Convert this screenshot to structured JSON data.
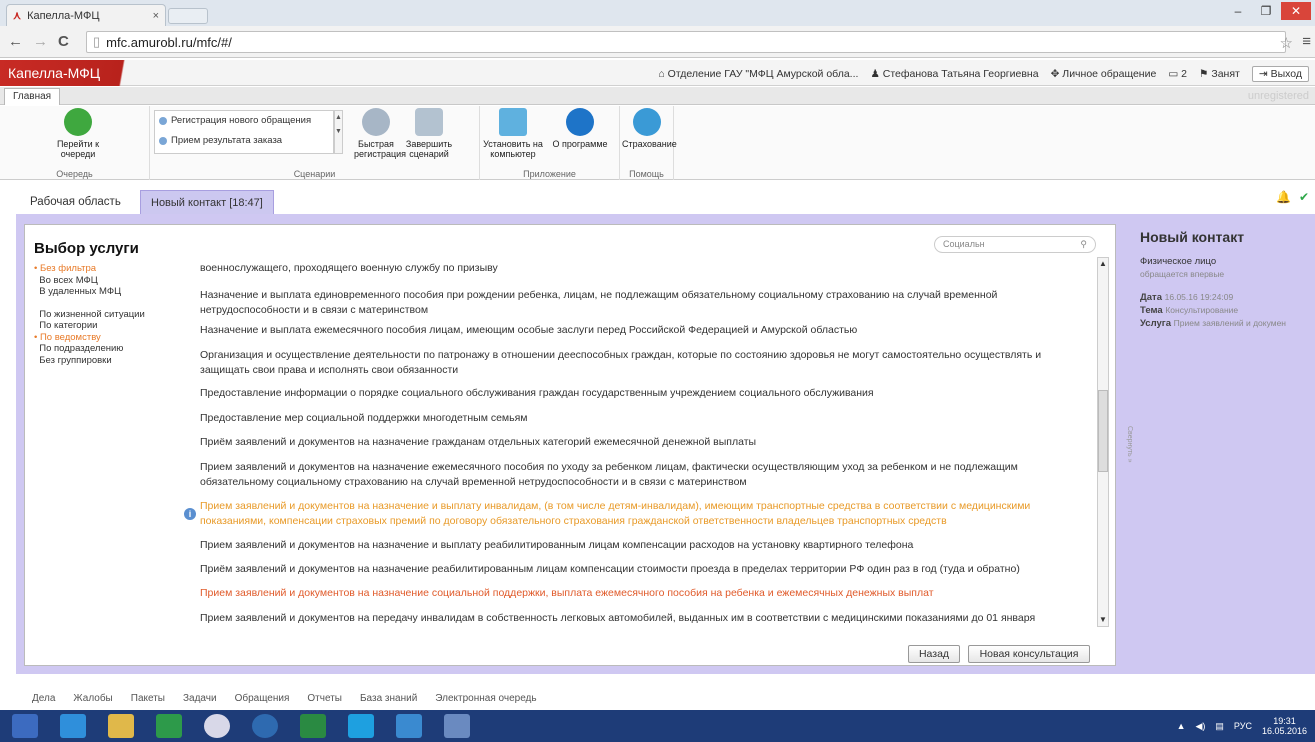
{
  "browser": {
    "tab_title": "Капелла-МФЦ",
    "tab_close": "×",
    "url": "mfc.amurobl.ru/mfc/#/"
  },
  "header": {
    "logo": "Капелла-МФЦ",
    "office": "Отделение ГАУ \"МФЦ Амурской обла...",
    "user": "Стефанова Татьяна Георгиевна",
    "mode": "Личное обращение",
    "window": "2",
    "status": "Занят",
    "logout": "Выход"
  },
  "ribbon": {
    "tab": "Главная",
    "unregistered": "unregistered",
    "queue_btn": "Перейти к очереди",
    "queue_group": "Очередь",
    "scenarios": [
      "Регистрация нового обращения",
      "Прием результата заказа"
    ],
    "quick_reg": "Быстрая регистрация",
    "finish_scenario": "Завершить сценарий",
    "scenarios_group": "Сценарии",
    "install": "Установить на компьютер",
    "about": "О программе",
    "app_group": "Приложение",
    "insurance": "Страхование",
    "help_group": "Помощь"
  },
  "tabs": {
    "workspace": "Рабочая область",
    "new_contact": "Новый контакт [18:47]"
  },
  "panel": {
    "title": "Выбор услуги",
    "search_placeholder": "Социальн",
    "filters": {
      "no_filter": "Без фильтра",
      "all_mfc": "Во всех МФЦ",
      "remote_mfc": "В удаленных МФЦ",
      "life_situation": "По жизненной ситуации",
      "category": "По категории",
      "by_department": "По ведомству",
      "by_subdivision": "По подразделению",
      "no_grouping": "Без группировки"
    },
    "services": [
      "военнослужащего, проходящего военную службу по призыву",
      "Назначение и выплата единовременного пособия при рождении ребенка, лицам, не подлежащим обязательному социальному страхованию на случай временной нетрудоспособности и в связи с материнством",
      "Назначение и выплата ежемесячного пособия лицам, имеющим особые заслуги перед Российской Федерацией и Амурской областью",
      "Организация и осуществление деятельности по патронажу в отношении дееспособных граждан, которые по состоянию здоровья не могут самостоятельно осуществлять и защищать свои права и исполнять свои обязанности",
      "Предоставление информации о порядке социального обслуживания граждан государственным учреждением социального обслуживания",
      "Предоставление мер социальной поддержки многодетным семьям",
      "Приём заявлений и документов на назначение гражданам отдельных категорий ежемесячной денежной выплаты",
      "Прием заявлений и документов на назначение ежемесячного пособия по уходу за ребенком лицам, фактически осуществляющим уход за ребенком и не подлежащим обязательному социальному страхованию на случай временной нетрудоспособности и в связи с материнством",
      "Прием заявлений и документов на назначение и выплату инвалидам, (в том числе детям-инвалидам), имеющим транспортные средства в соответствии с медицинскими показаниями, компенсации страховых премий по договору обязательного страхования гражданской ответственности владельцев транспортных средств",
      "Прием заявлений и документов на назначение и выплату реабилитированным лицам компенсации расходов на установку квартирного телефона",
      "Приём заявлений и документов на назначение реабилитированным лицам компенсации стоимости проезда в пределах территории РФ один раз в год (туда и обратно)",
      "Прием заявлений и документов на назначение социальной поддержки, выплата ежемесячного пособия на ребенка и ежемесячных денежных выплат",
      "Прием заявлений и документов на передачу инвалидам в собственность легковых автомобилей, выданных им в соответствии с медицинскими показаниями до 01 января"
    ],
    "back": "Назад",
    "new_consult": "Новая консультация"
  },
  "contact": {
    "title": "Новый контакт",
    "person": "Физическое лицо",
    "first_time": "обращается впервые",
    "date_label": "Дата",
    "date_value": "16.05.16 19:24:09",
    "topic_label": "Тема",
    "topic_value": "Консультирование",
    "service_label": "Услуга",
    "service_value": "Прием заявлений и докумен",
    "collapse": "Свернуть »"
  },
  "bottom_nav": [
    "Дела",
    "Жалобы",
    "Пакеты",
    "Задачи",
    "Обращения",
    "Отчеты",
    "База знаний",
    "Электронная очередь"
  ],
  "taskbar": {
    "lang": "РУС",
    "time": "19:31",
    "date": "16.05.2016"
  }
}
